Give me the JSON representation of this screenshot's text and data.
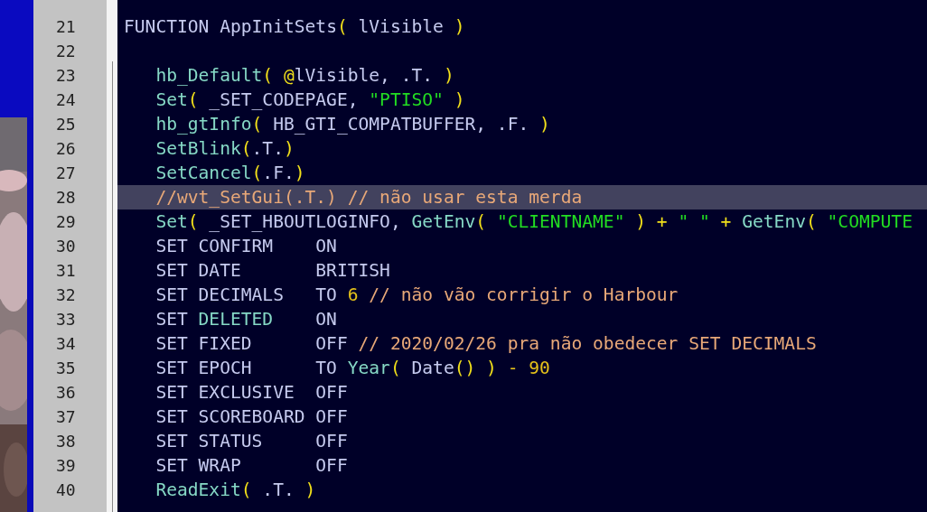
{
  "editor": {
    "lines": [
      {
        "number": "21",
        "highlighted": false,
        "indented": false,
        "tokens": [
          {
            "text": "FUNCTION AppInitSets",
            "kind": "plain"
          },
          {
            "text": "( ",
            "kind": "paren"
          },
          {
            "text": "lVisible ",
            "kind": "plain"
          },
          {
            "text": ")",
            "kind": "paren"
          }
        ]
      },
      {
        "number": "22",
        "highlighted": false
      },
      {
        "number": "23",
        "highlighted": false,
        "indented": true,
        "tokens": [
          {
            "text": "hb_Default",
            "kind": "function"
          },
          {
            "text": "( @",
            "kind": "paren"
          },
          {
            "text": "lVisible, .T. ",
            "kind": "plain"
          },
          {
            "text": ")",
            "kind": "paren"
          }
        ]
      },
      {
        "number": "24",
        "highlighted": false,
        "indented": true,
        "tokens": [
          {
            "text": "Set",
            "kind": "function"
          },
          {
            "text": "( ",
            "kind": "paren"
          },
          {
            "text": "_SET_CODEPAGE, ",
            "kind": "plain"
          },
          {
            "text": "\"PTISO\" ",
            "kind": "string"
          },
          {
            "text": ")",
            "kind": "paren"
          }
        ]
      },
      {
        "number": "25",
        "highlighted": false,
        "indented": true,
        "tokens": [
          {
            "text": "hb_gtInfo",
            "kind": "function"
          },
          {
            "text": "( ",
            "kind": "paren"
          },
          {
            "text": "HB_GTI_COMPATBUFFER, .F. ",
            "kind": "plain"
          },
          {
            "text": ")",
            "kind": "paren"
          }
        ]
      },
      {
        "number": "26",
        "highlighted": false,
        "indented": true,
        "tokens": [
          {
            "text": "SetBlink",
            "kind": "function"
          },
          {
            "text": "(",
            "kind": "paren"
          },
          {
            "text": ".T.",
            "kind": "plain"
          },
          {
            "text": ")",
            "kind": "paren"
          }
        ]
      },
      {
        "number": "27",
        "highlighted": false,
        "indented": true,
        "tokens": [
          {
            "text": "SetCancel",
            "kind": "function"
          },
          {
            "text": "(",
            "kind": "paren"
          },
          {
            "text": ".F.",
            "kind": "plain"
          },
          {
            "text": ")",
            "kind": "paren"
          }
        ]
      },
      {
        "number": "28",
        "highlighted": true,
        "indented": true,
        "tokens": [
          {
            "text": "//wvt_SetGui(.T.) // não usar esta merda",
            "kind": "comment"
          }
        ]
      },
      {
        "number": "29",
        "highlighted": false,
        "indented": true,
        "tokens": [
          {
            "text": "Set",
            "kind": "function"
          },
          {
            "text": "( ",
            "kind": "paren"
          },
          {
            "text": "_SET_HBOUTLOGINFO, ",
            "kind": "plain"
          },
          {
            "text": "GetEnv",
            "kind": "function"
          },
          {
            "text": "( ",
            "kind": "paren"
          },
          {
            "text": "\"CLIENTNAME\" ",
            "kind": "string"
          },
          {
            "text": ") + ",
            "kind": "paren"
          },
          {
            "text": "\" \" ",
            "kind": "string"
          },
          {
            "text": "+ ",
            "kind": "paren"
          },
          {
            "text": "GetEnv",
            "kind": "function"
          },
          {
            "text": "( ",
            "kind": "paren"
          },
          {
            "text": "\"COMPUTE",
            "kind": "string"
          }
        ]
      },
      {
        "number": "30",
        "highlighted": false,
        "indented": true,
        "tokens": [
          {
            "text": "SET CONFIRM    ON",
            "kind": "plain"
          }
        ]
      },
      {
        "number": "31",
        "highlighted": false,
        "indented": true,
        "tokens": [
          {
            "text": "SET DATE       BRITISH",
            "kind": "plain"
          }
        ]
      },
      {
        "number": "32",
        "highlighted": false,
        "indented": true,
        "tokens": [
          {
            "text": "SET DECIMALS   TO ",
            "kind": "plain"
          },
          {
            "text": "6",
            "kind": "number"
          },
          {
            "text": " // não vão corrigir o Harbour",
            "kind": "comment"
          }
        ]
      },
      {
        "number": "33",
        "highlighted": false,
        "indented": true,
        "tokens": [
          {
            "text": "SET ",
            "kind": "plain"
          },
          {
            "text": "DELETED",
            "kind": "function"
          },
          {
            "text": "    ON",
            "kind": "plain"
          }
        ]
      },
      {
        "number": "34",
        "highlighted": false,
        "indented": true,
        "tokens": [
          {
            "text": "SET FIXED      OFF ",
            "kind": "plain"
          },
          {
            "text": "// 2020/02/26 pra não obedecer SET DECIMALS",
            "kind": "comment"
          }
        ]
      },
      {
        "number": "35",
        "highlighted": false,
        "indented": true,
        "tokens": [
          {
            "text": "SET EPOCH      TO ",
            "kind": "plain"
          },
          {
            "text": "Year",
            "kind": "function"
          },
          {
            "text": "( ",
            "kind": "paren"
          },
          {
            "text": "Date",
            "kind": "plain"
          },
          {
            "text": "() ) ",
            "kind": "paren"
          },
          {
            "text": "- 90",
            "kind": "number"
          }
        ]
      },
      {
        "number": "36",
        "highlighted": false,
        "indented": true,
        "tokens": [
          {
            "text": "SET EXCLUSIVE  OFF",
            "kind": "plain"
          }
        ]
      },
      {
        "number": "37",
        "highlighted": false,
        "indented": true,
        "tokens": [
          {
            "text": "SET SCOREBOARD OFF",
            "kind": "plain"
          }
        ]
      },
      {
        "number": "38",
        "highlighted": false,
        "indented": true,
        "tokens": [
          {
            "text": "SET STATUS     OFF",
            "kind": "plain"
          }
        ]
      },
      {
        "number": "39",
        "highlighted": false,
        "indented": true,
        "tokens": [
          {
            "text": "SET WRAP       OFF",
            "kind": "plain"
          }
        ]
      },
      {
        "number": "40",
        "highlighted": false,
        "indented": true,
        "tokens": [
          {
            "text": "ReadExit",
            "kind": "function"
          },
          {
            "text": "( ",
            "kind": "paren"
          },
          {
            "text": ".T. ",
            "kind": "plain"
          },
          {
            "text": ")",
            "kind": "paren"
          }
        ]
      }
    ]
  }
}
